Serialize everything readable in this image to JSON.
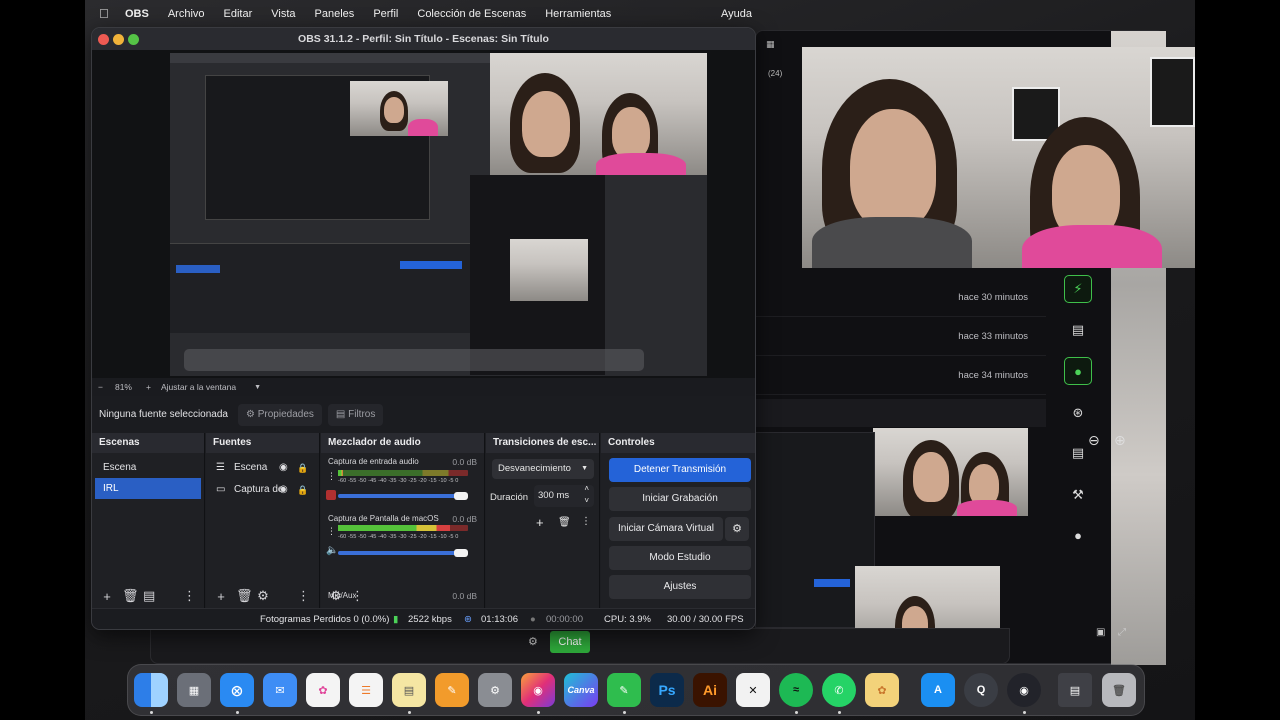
{
  "menubar": {
    "app_name": "OBS",
    "items": [
      "Archivo",
      "Editar",
      "Vista",
      "Paneles",
      "Perfil",
      "Colección de Escenas",
      "Herramientas"
    ],
    "help": "Ayuda"
  },
  "window": {
    "title": "OBS 31.1.2 - Perfil: Sin Título - Escenas: Sin Título"
  },
  "zoom": {
    "minus": "−",
    "value": "81%",
    "plus": "+",
    "fit_label": "Ajustar a la ventana"
  },
  "source_bar": {
    "no_selection": "Ninguna fuente seleccionada",
    "properties": "Propiedades",
    "filters": "Filtros"
  },
  "scenes": {
    "title": "Escenas",
    "items": [
      "Escena",
      "IRL"
    ],
    "selected_index": 1
  },
  "sources": {
    "title": "Fuentes",
    "items": [
      {
        "label": "Escena",
        "icon": "list-icon"
      },
      {
        "label": "Captura de",
        "icon": "monitor-icon"
      }
    ]
  },
  "mixer": {
    "title": "Mezclador de audio",
    "channels": [
      {
        "name": "Captura de entrada audio",
        "db": "0.0 dB",
        "level": 0.1,
        "muted": true
      },
      {
        "name": "Captura de Pantalla de macOS",
        "db": "0.0 dB",
        "level": 0.95,
        "muted": false
      },
      {
        "name": "Mic/Aux",
        "db": "0.0 dB"
      }
    ],
    "scale": "-60 -55 -50 -45 -40 -35 -30 -25 -20 -15 -10 -5 0"
  },
  "transitions": {
    "title": "Transiciones de esc...",
    "type": "Desvanecimiento",
    "duration_label": "Duración",
    "duration_value": "300 ms"
  },
  "controls": {
    "title": "Controles",
    "buttons": [
      "Detener Transmisión",
      "Iniciar Grabación",
      "Iniciar Cámara Virtual",
      "Modo Estudio",
      "Ajustes"
    ]
  },
  "status": {
    "dropped": "Fotogramas Perdidos 0 (0.0%)",
    "bitrate": "2522 kbps",
    "stream_time": "01:13:06",
    "rec_time": "00:00:00",
    "cpu": "CPU: 3.9%",
    "fps": "30.00 / 30.00 FPS"
  },
  "background_window": {
    "notifications": [
      "hace 30 minutos",
      "hace 33 minutos",
      "hace 34 minutos"
    ],
    "chat_button": "Chat",
    "tab_count": "(24)"
  },
  "dock_apps": [
    "Finder",
    "Launchpad",
    "Safari",
    "Mail",
    "Fotos",
    "Recordatorios",
    "Notas",
    "Pages",
    "Ajustes del Sistema",
    "Instagram",
    "Canva",
    "Notas de voz",
    "Photoshop",
    "Illustrator",
    "CapCut",
    "Spotify",
    "WhatsApp",
    "Pixelmator",
    "App Store",
    "QuickTime",
    "OBS",
    "Documentos",
    "Papelera"
  ],
  "dock_icon_labels": {
    "canva": "Canva",
    "ps": "Ps",
    "ai": "Ai"
  },
  "colors": {
    "accent": "#2463d8",
    "green": "#2faa3b",
    "window_bg": "#1d1e22"
  }
}
